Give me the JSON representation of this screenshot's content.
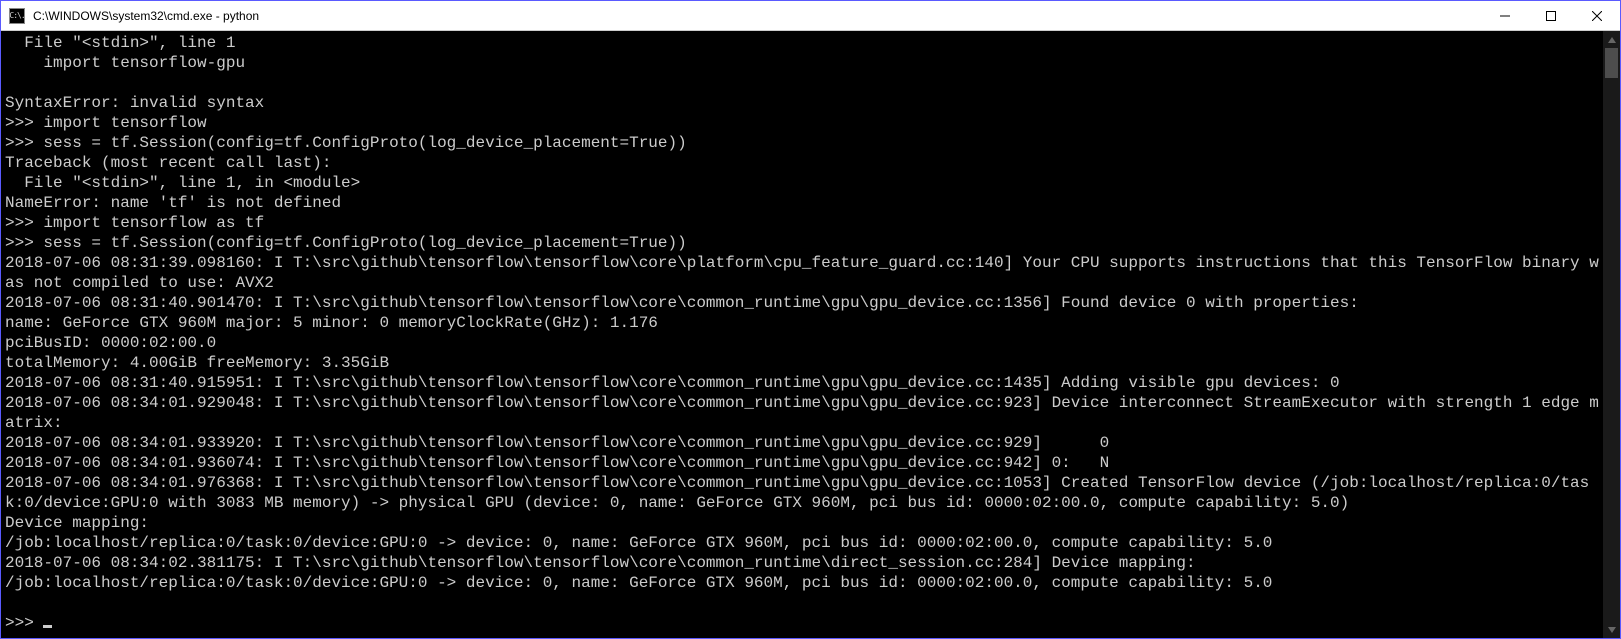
{
  "window": {
    "title": "C:\\WINDOWS\\system32\\cmd.exe - python",
    "icon_text": "C:\\."
  },
  "terminal": {
    "lines": [
      "  File \"<stdin>\", line 1",
      "    import tensorflow-gpu",
      "",
      "SyntaxError: invalid syntax",
      ">>> import tensorflow",
      ">>> sess = tf.Session(config=tf.ConfigProto(log_device_placement=True))",
      "Traceback (most recent call last):",
      "  File \"<stdin>\", line 1, in <module>",
      "NameError: name 'tf' is not defined",
      ">>> import tensorflow as tf",
      ">>> sess = tf.Session(config=tf.ConfigProto(log_device_placement=True))",
      "2018-07-06 08:31:39.098160: I T:\\src\\github\\tensorflow\\tensorflow\\core\\platform\\cpu_feature_guard.cc:140] Your CPU supports instructions that this TensorFlow binary was not compiled to use: AVX2",
      "2018-07-06 08:31:40.901470: I T:\\src\\github\\tensorflow\\tensorflow\\core\\common_runtime\\gpu\\gpu_device.cc:1356] Found device 0 with properties:",
      "name: GeForce GTX 960M major: 5 minor: 0 memoryClockRate(GHz): 1.176",
      "pciBusID: 0000:02:00.0",
      "totalMemory: 4.00GiB freeMemory: 3.35GiB",
      "2018-07-06 08:31:40.915951: I T:\\src\\github\\tensorflow\\tensorflow\\core\\common_runtime\\gpu\\gpu_device.cc:1435] Adding visible gpu devices: 0",
      "2018-07-06 08:34:01.929048: I T:\\src\\github\\tensorflow\\tensorflow\\core\\common_runtime\\gpu\\gpu_device.cc:923] Device interconnect StreamExecutor with strength 1 edge matrix:",
      "2018-07-06 08:34:01.933920: I T:\\src\\github\\tensorflow\\tensorflow\\core\\common_runtime\\gpu\\gpu_device.cc:929]      0",
      "2018-07-06 08:34:01.936074: I T:\\src\\github\\tensorflow\\tensorflow\\core\\common_runtime\\gpu\\gpu_device.cc:942] 0:   N",
      "2018-07-06 08:34:01.976368: I T:\\src\\github\\tensorflow\\tensorflow\\core\\common_runtime\\gpu\\gpu_device.cc:1053] Created TensorFlow device (/job:localhost/replica:0/task:0/device:GPU:0 with 3083 MB memory) -> physical GPU (device: 0, name: GeForce GTX 960M, pci bus id: 0000:02:00.0, compute capability: 5.0)",
      "Device mapping:",
      "/job:localhost/replica:0/task:0/device:GPU:0 -> device: 0, name: GeForce GTX 960M, pci bus id: 0000:02:00.0, compute capability: 5.0",
      "2018-07-06 08:34:02.381175: I T:\\src\\github\\tensorflow\\tensorflow\\core\\common_runtime\\direct_session.cc:284] Device mapping:",
      "/job:localhost/replica:0/task:0/device:GPU:0 -> device: 0, name: GeForce GTX 960M, pci bus id: 0000:02:00.0, compute capability: 5.0",
      "",
      ">>> "
    ]
  }
}
